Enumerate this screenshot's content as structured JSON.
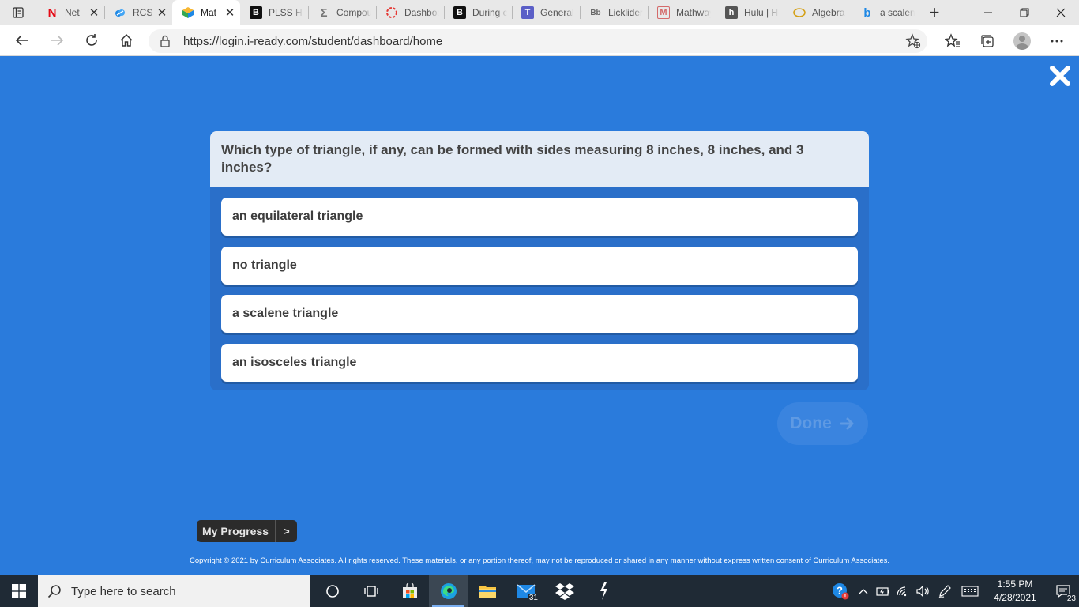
{
  "browser": {
    "tabs": [
      {
        "label": "Net",
        "icon": "netflix-icon",
        "active": false,
        "has_close": true
      },
      {
        "label": "RCS",
        "icon": "cloud-icon",
        "active": false,
        "has_close": true
      },
      {
        "label": "Mat",
        "icon": "iready-icon",
        "active": true,
        "has_close": true
      },
      {
        "label": "PLSS HEL",
        "icon": "b-icon",
        "active": false,
        "has_close": false
      },
      {
        "label": "Compou",
        "icon": "sigma-icon",
        "active": false,
        "has_close": false
      },
      {
        "label": "Dashboa",
        "icon": "canvas-icon",
        "active": false,
        "has_close": false
      },
      {
        "label": "During e",
        "icon": "b-icon",
        "active": false,
        "has_close": false
      },
      {
        "label": "General",
        "icon": "teams-icon",
        "active": false,
        "has_close": false
      },
      {
        "label": "Licklider",
        "icon": "blackboard-icon",
        "active": false,
        "has_close": false
      },
      {
        "label": "Mathway",
        "icon": "mathway-icon",
        "active": false,
        "has_close": false
      },
      {
        "label": "Hulu | Ho",
        "icon": "hulu-icon",
        "active": false,
        "has_close": false
      },
      {
        "label": "Algebra",
        "icon": "coin-icon",
        "active": false,
        "has_close": false
      },
      {
        "label": "a scalene",
        "icon": "bing-icon",
        "active": false,
        "has_close": false
      }
    ],
    "bb_glyph": "Bb",
    "url": "https://login.i-ready.com/student/dashboard/home"
  },
  "question": {
    "prompt": "Which type of triangle, if any, can be formed with sides measuring 8 inches, 8 inches, and 3 inches?",
    "choices": [
      {
        "label": "an equilateral triangle"
      },
      {
        "label": "no triangle"
      },
      {
        "label": "a scalene triangle"
      },
      {
        "label": "an isosceles triangle"
      }
    ]
  },
  "done_label": "Done",
  "progress": {
    "label": "My Progress",
    "chevron": ">"
  },
  "copyright": "Copyright © 2021 by Curriculum Associates. All rights reserved. These materials, or any portion thereof, may not be reproduced or shared in any manner without express written consent of Curriculum Associates.",
  "taskbar": {
    "search_placeholder": "Type here to search",
    "mail_badge": "31",
    "time": "1:55 PM",
    "date": "4/28/2021",
    "notification_count": "23"
  },
  "colors": {
    "page_background": "#2a7bdc",
    "card_background": "#2a6fc9",
    "question_header": "#e3ebf5",
    "taskbar": "#1f2a35"
  }
}
